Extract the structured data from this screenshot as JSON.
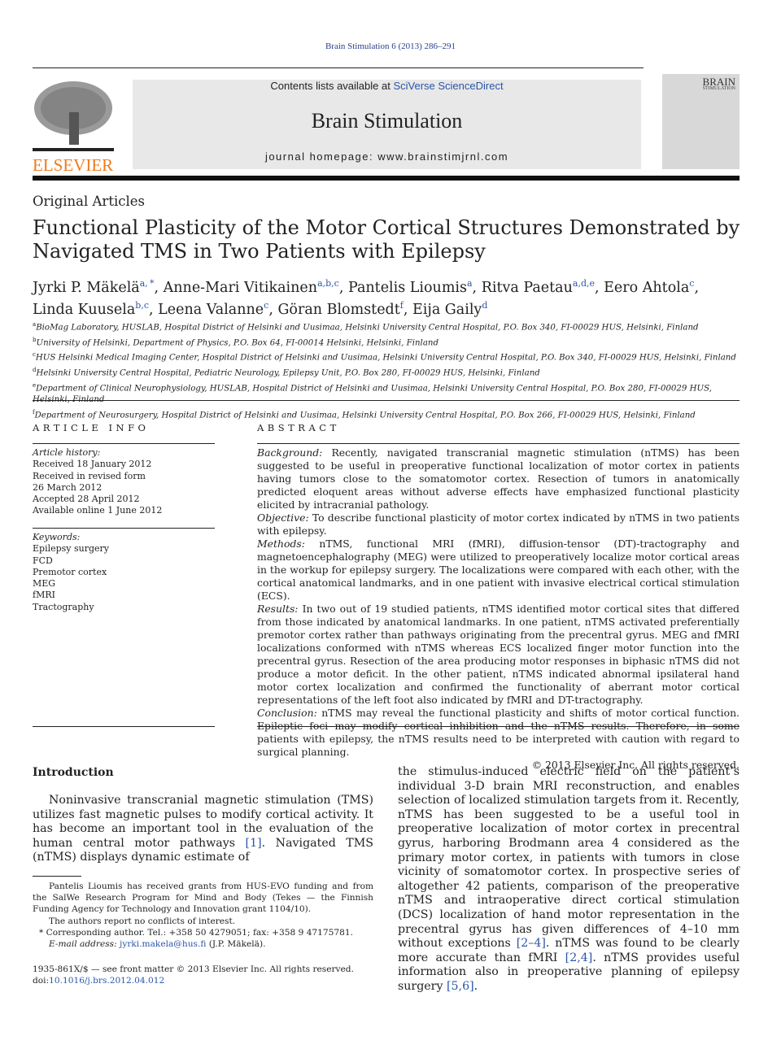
{
  "header": {
    "citation": "Brain Stimulation 6 (2013) 286–291",
    "contents_prefix": "Contents lists available at ",
    "contents_link": "SciVerse ScienceDirect",
    "journal_title": "Brain Stimulation",
    "homepage": "journal homepage: www.brainstimjrnl.com",
    "publisher_logo": "ELSEVIER",
    "cover_title": "BRAIN",
    "cover_subtitle": "STIMULATION"
  },
  "article": {
    "section": "Original Articles",
    "title": "Functional Plasticity of the Motor Cortical Structures Demonstrated by Navigated TMS in Two Patients with Epilepsy",
    "authors": [
      {
        "name": "Jyrki P. Mäkelä",
        "sup": "a, *",
        "sep": ", "
      },
      {
        "name": "Anne-Mari Vitikainen",
        "sup": "a,b,c",
        "sep": ", "
      },
      {
        "name": "Pantelis Lioumis",
        "sup": "a",
        "sep": ", "
      },
      {
        "name": "Ritva Paetau",
        "sup": "a,d,e",
        "sep": ", "
      },
      {
        "name": "Eero Ahtola",
        "sup": "c",
        "sep": ","
      },
      {
        "name": "Linda Kuusela",
        "sup": "b,c",
        "sep": ", "
      },
      {
        "name": "Leena Valanne",
        "sup": "c",
        "sep": ", "
      },
      {
        "name": "Göran Blomstedt",
        "sup": "f",
        "sep": ", "
      },
      {
        "name": "Eija Gaily",
        "sup": "d",
        "sep": ""
      }
    ],
    "affiliations": [
      {
        "key": "a",
        "text": "BioMag Laboratory, HUSLAB, Hospital District of Helsinki and Uusimaa, Helsinki University Central Hospital, P.O. Box 340, FI-00029 HUS, Helsinki, Finland"
      },
      {
        "key": "b",
        "text": "University of Helsinki, Department of Physics, P.O. Box 64, FI-00014 Helsinki, Helsinki, Finland"
      },
      {
        "key": "c",
        "text": "HUS Helsinki Medical Imaging Center, Hospital District of Helsinki and Uusimaa, Helsinki University Central Hospital, P.O. Box 340, FI-00029 HUS, Helsinki, Finland"
      },
      {
        "key": "d",
        "text": "Helsinki University Central Hospital, Pediatric Neurology, Epilepsy Unit, P.O. Box 280, FI-00029 HUS, Helsinki, Finland"
      },
      {
        "key": "e",
        "text": "Department of Clinical Neurophysiology, HUSLAB, Hospital District of Helsinki and Uusimaa, Helsinki University Central Hospital, P.O. Box 280, FI-00029 HUS, Helsinki, Finland"
      },
      {
        "key": "f",
        "text": "Department of Neurosurgery, Hospital District of Helsinki and Uusimaa, Helsinki University Central Hospital, P.O. Box 266, FI-00029 HUS, Helsinki, Finland"
      }
    ]
  },
  "article_info": {
    "heading": "ARTICLE INFO",
    "history_label": "Article history:",
    "history": [
      "Received 18 January 2012",
      "Received in revised form",
      "26 March 2012",
      "Accepted 28 April 2012",
      "Available online 1 June 2012"
    ],
    "keywords_label": "Keywords:",
    "keywords": [
      "Epilepsy surgery",
      "FCD",
      "Premotor cortex",
      "MEG",
      "fMRI",
      "Tractography"
    ]
  },
  "abstract": {
    "heading": "ABSTRACT",
    "sections": [
      {
        "label": "Background:",
        "text": " Recently, navigated transcranial magnetic stimulation (nTMS) has been suggested to be useful in preoperative functional localization of motor cortex in patients having tumors close to the somatomotor cortex. Resection of tumors in anatomically predicted eloquent areas without adverse effects have emphasized functional plasticity elicited by intracranial pathology."
      },
      {
        "label": "Objective:",
        "text": " To describe functional plasticity of motor cortex indicated by nTMS in two patients with epilepsy."
      },
      {
        "label": "Methods:",
        "text": " nTMS, functional MRI (fMRI), diffusion-tensor (DT)-tractography and magnetoencephalography (MEG) were utilized to preoperatively localize motor cortical areas in the workup for epilepsy surgery. The localizations were compared with each other, with the cortical anatomical landmarks, and in one patient with invasive electrical cortical stimulation (ECS)."
      },
      {
        "label": "Results:",
        "text": " In two out of 19 studied patients, nTMS identified motor cortical sites that differed from those indicated by anatomical landmarks. In one patient, nTMS activated preferentially premotor cortex rather than pathways originating from the precentral gyrus. MEG and fMRI localizations conformed with nTMS whereas ECS localized finger motor function into the precentral gyrus. Resection of the area producing motor responses in biphasic nTMS did not produce a motor deficit. In the other patient, nTMS indicated abnormal ipsilateral hand motor cortex localization and confirmed the functionality of aberrant motor cortical representations of the left foot also indicated by fMRI and DT-tractography."
      },
      {
        "label": "Conclusion:",
        "text": " nTMS may reveal the functional plasticity and shifts of motor cortical function. Epileptic foci may modify cortical inhibition and the nTMS results. Therefore, in some patients with epilepsy, the nTMS results need to be interpreted with caution with regard to surgical planning."
      }
    ],
    "copyright": "© 2013 Elsevier Inc. All rights reserved."
  },
  "intro": {
    "heading": "Introduction",
    "para1": [
      {
        "t": "Noninvasive transcranial magnetic stimulation (TMS) utilizes fast magnetic pulses to modify cortical activity. It has become an important tool in the evaluation of the human central motor pathways "
      },
      {
        "t": "[1]",
        "link": true
      },
      {
        "t": ". Navigated TMS (nTMS) displays dynamic estimate of"
      }
    ],
    "para2": [
      {
        "t": "the stimulus-induced electric field on the patient’s individual 3-D brain MRI reconstruction, and enables selection of localized stimulation targets from it. Recently, nTMS has been suggested to be a useful tool in preoperative localization of motor cortex in precentral gyrus, harboring Brodmann area 4 considered as the primary motor cortex, in patients with tumors in close vicinity of somatomotor cortex. In prospective series of altogether 42 patients, comparison of the preoperative nTMS and intraoperative direct cortical stimulation (DCS) localization of hand motor representation in the precentral gyrus has given differences of 4–10 mm without exceptions "
      },
      {
        "t": "[2–4]",
        "link": true
      },
      {
        "t": ". nTMS was found to be clearly more accurate than fMRI "
      },
      {
        "t": "[2,4]",
        "link": true
      },
      {
        "t": ". nTMS provides useful information also in preoperative planning of epilepsy surgery "
      },
      {
        "t": "[5,6]",
        "link": true
      },
      {
        "t": "."
      }
    ]
  },
  "footnotes": {
    "funding": "Pantelis Lioumis has received grants from HUS-EVO funding and from the SalWe Research Program for Mind and Body (Tekes — the Finnish Funding Agency for Technology and Innovation grant 1104/10).",
    "conflicts": "The authors report no conflicts of interest.",
    "corresponding": "Corresponding author. Tel.: +358 50 4279051; fax: +358 9 47175781.",
    "email_label": "E-mail address:",
    "email": "jyrki.makela@hus.fi",
    "email_name": " (J.P. Mäkelä).",
    "front_matter": "1935-861X/$ — see front matter © 2013 Elsevier Inc. All rights reserved.",
    "doi_label": "doi:",
    "doi": "10.1016/j.brs.2012.04.012"
  },
  "colors": {
    "link": "#2a55a8",
    "elsevier_orange": "#f07a1a",
    "banner_bg": "#e8e8e8"
  }
}
